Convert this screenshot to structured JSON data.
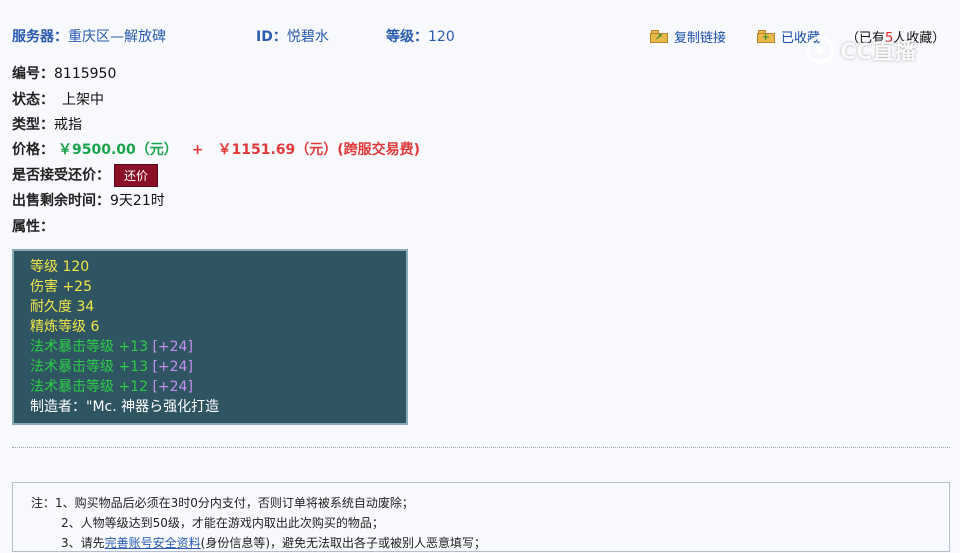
{
  "header": {
    "server_label": "服务器：",
    "server_value": "重庆区—解放碑",
    "id_label": "ID：",
    "id_value": "悦碧水",
    "level_label": "等级：",
    "level_value": "120",
    "copy_link": "复制链接",
    "favorited": "已收藏",
    "fav_count_prefix": "（已有",
    "fav_count": "5",
    "fav_count_suffix": "人收藏）"
  },
  "watermark": "CC直播",
  "details": {
    "number_label": "编号：",
    "number_value": "8115950",
    "status_label": "状态：",
    "status_value": "上架中",
    "type_label": "类型：",
    "type_value": "戒指",
    "price_label": "价格：",
    "price_main": "￥9500.00（元）",
    "price_plus": "+",
    "price_fee": "￥1151.69（元）(跨服交易费)",
    "counter_label": "是否接受还价：",
    "counter_button": "还价",
    "time_label": "出售剩余时间：",
    "time_value": "9天21时",
    "attr_label": "属性："
  },
  "attributes": {
    "level": "等级 120",
    "damage": "伤害 +25",
    "durability": "耐久度 34",
    "refine": "精炼等级 6",
    "crit1_main": "法术暴击等级 +13",
    "crit1_bonus": "[+24]",
    "crit2_main": "法术暴击等级 +13",
    "crit2_bonus": "[+24]",
    "crit3_main": "法术暴击等级 +12",
    "crit3_bonus": "[+24]",
    "maker": "制造者：\"Mc. 神器ら强化打造"
  },
  "notice": {
    "line1": "注：1、购买物品后必须在3时0分内支付，否则订单将被系统自动废除；",
    "line2": "2、人物等级达到50级，才能在游戏内取出此次购买的物品；",
    "line3_pre": "3、请先",
    "line3_link": "完善账号安全资料",
    "line3_post": "(身份信息等)，避免无法取出各子或被别人恶意填写；"
  },
  "colors": {
    "link_blue": "#2a5bb0",
    "price_green": "#1aa34a",
    "price_red": "#e03a3a",
    "counter_button_bg": "#8a1028",
    "attr_box_bg": "#2f5462",
    "attr_yellow": "#f0e64a",
    "attr_green": "#2ccc45",
    "attr_purple": "#c490f0"
  },
  "icons": {
    "copy_link": "folder-link-icon",
    "favorited": "folder-star-icon",
    "watermark_logo": "cc-logo-icon"
  }
}
